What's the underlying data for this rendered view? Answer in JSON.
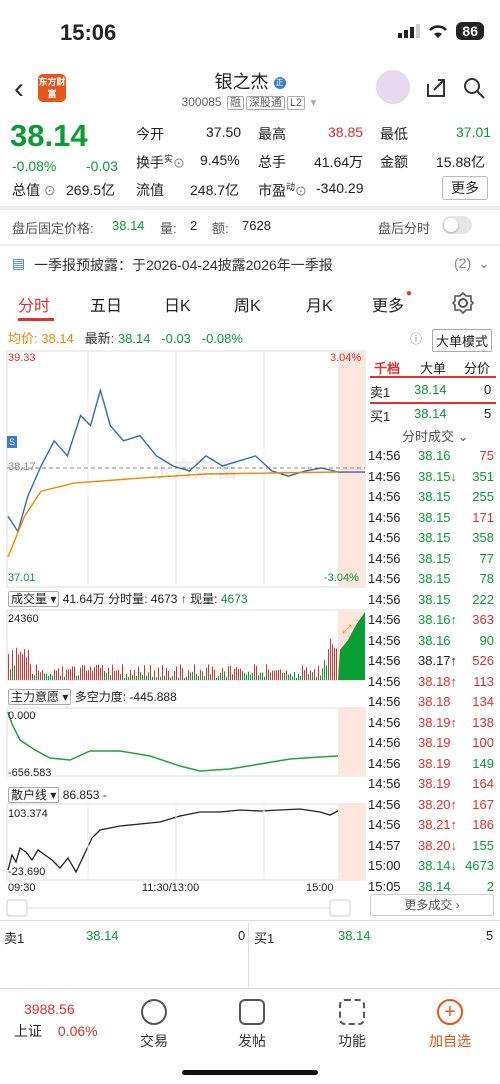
{
  "status": {
    "time": "15:06",
    "battery": "86"
  },
  "header": {
    "logo_text": "东方财富",
    "name": "银之杰",
    "code": "300085",
    "tag1": "融",
    "tag2": "深股通",
    "tag3": "L2"
  },
  "quote": {
    "price": "38.14",
    "change_pct": "-0.08%",
    "change": "-0.03",
    "open_label": "今开",
    "open": "37.50",
    "high_label": "最高",
    "high": "38.85",
    "low_label": "最低",
    "low": "37.01",
    "turnover_label": "换手",
    "turnover_sup": "实",
    "turnover": "9.45%",
    "vol_label": "总手",
    "vol": "41.64万",
    "amount_label": "金额",
    "amount": "15.88亿",
    "mcap_label": "总值",
    "mcap": "269.5亿",
    "float_label": "流值",
    "float": "248.7亿",
    "pe_label": "市盈",
    "pe_sup": "动",
    "pe": "-340.29",
    "more": "更多"
  },
  "afterhours": {
    "label": "盘后固定价格:",
    "price": "38.14",
    "qty_label": "量:",
    "qty": "2",
    "amt_label": "额:",
    "amt": "7628",
    "toggle_label": "盘后分时"
  },
  "notice": {
    "text": "一季报预披露：于2026-04-24披露2026年一季报",
    "count": "(2)"
  },
  "tabs": [
    "分时",
    "五日",
    "日K",
    "周K",
    "月K",
    "更多"
  ],
  "chart_header": {
    "avg_label": "均价:",
    "avg": "38.14",
    "latest_label": "最新:",
    "latest": "38.14",
    "chg": "-0.03",
    "pct": "-0.08%",
    "dadan": "大单模式"
  },
  "chart_labels": {
    "top_price": "39.33",
    "bottom_price": "37.01",
    "top_pct": "3.04%",
    "bottom_pct": "-3.04%",
    "mid_price": "38.17",
    "s_marker": "S",
    "watermark": "东方财富",
    "vol_dropdown": "成交量",
    "vol_total": "41.64万",
    "vol_detail_label": "分时量:",
    "vol_detail": "4673",
    "vol_now_label": "现量:",
    "vol_now": "4673",
    "vol_max": "24360",
    "main_dropdown": "主力意愿",
    "main_label": "多空力度:",
    "main_val": "-445.888",
    "main_top": "0.000",
    "main_bottom": "-656.583",
    "retail_dropdown": "散户线",
    "retail_val": "86.853 -",
    "retail_top": "103.374",
    "retail_bottom": "-23.690",
    "time_start": "09:30",
    "time_mid": "11:30/13:00",
    "time_end": "15:00"
  },
  "chart_data": {
    "type": "line",
    "title": "",
    "x_range": [
      "09:30",
      "15:00"
    ],
    "ylim": [
      37.01,
      39.33
    ],
    "series": [
      {
        "name": "最新",
        "points": [
          [
            0,
            37.7
          ],
          [
            3,
            37.55
          ],
          [
            6,
            37.9
          ],
          [
            10,
            38.2
          ],
          [
            14,
            38.45
          ],
          [
            18,
            38.3
          ],
          [
            22,
            38.7
          ],
          [
            25,
            38.6
          ],
          [
            28,
            38.95
          ],
          [
            31,
            38.6
          ],
          [
            35,
            38.45
          ],
          [
            40,
            38.5
          ],
          [
            45,
            38.3
          ],
          [
            50,
            38.2
          ],
          [
            55,
            38.15
          ],
          [
            60,
            38.3
          ],
          [
            65,
            38.2
          ],
          [
            70,
            38.25
          ],
          [
            75,
            38.3
          ],
          [
            80,
            38.15
          ],
          [
            85,
            38.1
          ],
          [
            90,
            38.15
          ],
          [
            95,
            38.18
          ],
          [
            100,
            38.14
          ]
        ]
      },
      {
        "name": "均价",
        "points": [
          [
            0,
            37.3
          ],
          [
            5,
            37.7
          ],
          [
            10,
            37.95
          ],
          [
            20,
            38.03
          ],
          [
            40,
            38.08
          ],
          [
            60,
            38.12
          ],
          [
            80,
            38.13
          ],
          [
            100,
            38.14
          ]
        ]
      }
    ]
  },
  "sidepanel": {
    "tabs": [
      "千档",
      "大单",
      "分价"
    ],
    "sell1_label": "卖1",
    "sell1_price": "38.14",
    "sell1_qty": "0",
    "buy1_label": "买1",
    "buy1_price": "38.14",
    "buy1_qty": "5",
    "trades_title": "分时成交",
    "trades": [
      {
        "t": "14:56",
        "p": "38.16",
        "q": "75",
        "pc": "green",
        "qc": "red"
      },
      {
        "t": "14:56",
        "p": "38.15↓",
        "q": "351",
        "pc": "green",
        "qc": "green"
      },
      {
        "t": "14:56",
        "p": "38.15",
        "q": "255",
        "pc": "green",
        "qc": "green"
      },
      {
        "t": "14:56",
        "p": "38.15",
        "q": "171",
        "pc": "green",
        "qc": "red"
      },
      {
        "t": "14:56",
        "p": "38.15",
        "q": "358",
        "pc": "green",
        "qc": "green"
      },
      {
        "t": "14:56",
        "p": "38.15",
        "q": "77",
        "pc": "green",
        "qc": "green"
      },
      {
        "t": "14:56",
        "p": "38.15",
        "q": "78",
        "pc": "green",
        "qc": "green"
      },
      {
        "t": "14:56",
        "p": "38.15",
        "q": "222",
        "pc": "green",
        "qc": "green"
      },
      {
        "t": "14:56",
        "p": "38.16↑",
        "q": "363",
        "pc": "green",
        "qc": "red"
      },
      {
        "t": "14:56",
        "p": "38.16",
        "q": "90",
        "pc": "green",
        "qc": "green"
      },
      {
        "t": "14:56",
        "p": "38.17↑",
        "q": "526",
        "pc": "dark",
        "qc": "red"
      },
      {
        "t": "14:56",
        "p": "38.18↑",
        "q": "113",
        "pc": "red",
        "qc": "red"
      },
      {
        "t": "14:56",
        "p": "38.18",
        "q": "134",
        "pc": "red",
        "qc": "red"
      },
      {
        "t": "14:56",
        "p": "38.19↑",
        "q": "138",
        "pc": "red",
        "qc": "red"
      },
      {
        "t": "14:56",
        "p": "38.19",
        "q": "100",
        "pc": "red",
        "qc": "red"
      },
      {
        "t": "14:56",
        "p": "38.19",
        "q": "149",
        "pc": "red",
        "qc": "green"
      },
      {
        "t": "14:56",
        "p": "38.19",
        "q": "164",
        "pc": "red",
        "qc": "red"
      },
      {
        "t": "14:56",
        "p": "38.20↑",
        "q": "167",
        "pc": "red",
        "qc": "red"
      },
      {
        "t": "14:56",
        "p": "38.21↑",
        "q": "186",
        "pc": "red",
        "qc": "red"
      },
      {
        "t": "14:57",
        "p": "38.20↓",
        "q": "155",
        "pc": "red",
        "qc": "green"
      },
      {
        "t": "15:00",
        "p": "38.14↓",
        "q": "4673",
        "pc": "green",
        "qc": "green"
      },
      {
        "t": "15:05",
        "p": "38.14",
        "q": "2",
        "pc": "green",
        "qc": "green"
      }
    ],
    "more": "更多成交"
  },
  "orderbook": {
    "sell_label": "卖1",
    "sell_price": "38.14",
    "sell_qty": "0",
    "buy_label": "买1",
    "buy_price": "38.14",
    "buy_qty": "5"
  },
  "bottom": {
    "index_val": "3988.56",
    "index_name": "上证",
    "index_pct": "0.06%",
    "trade": "交易",
    "post": "发帖",
    "func": "功能",
    "add": "加自选"
  }
}
